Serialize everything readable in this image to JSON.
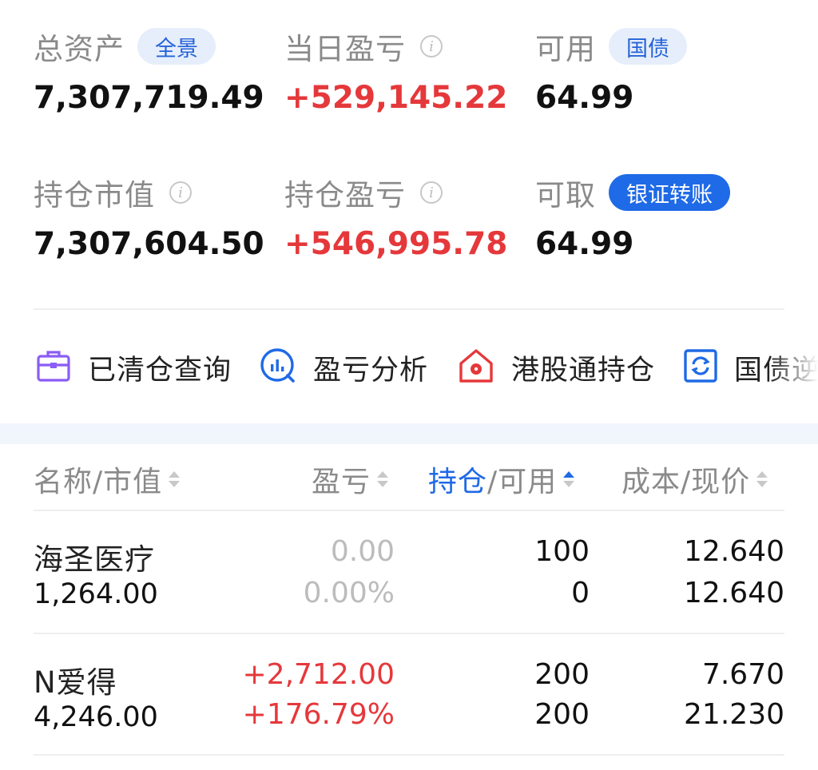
{
  "summary": {
    "total_assets": {
      "label": "总资产",
      "tag": "全景",
      "value": "7,307,719.49"
    },
    "today_pnl": {
      "label": "当日盈亏",
      "value": "+529,145.22"
    },
    "available": {
      "label": "可用",
      "tag": "国债",
      "value": "64.99"
    },
    "position_value": {
      "label": "持仓市值",
      "value": "7,307,604.50"
    },
    "position_pnl": {
      "label": "持仓盈亏",
      "value": "+546,995.78"
    },
    "withdrawable": {
      "label": "可取",
      "tag": "银证转账",
      "value": "64.99"
    }
  },
  "tools": [
    {
      "label": "已清仓查询",
      "icon": "briefcase-icon"
    },
    {
      "label": "盈亏分析",
      "icon": "analysis-icon"
    },
    {
      "label": "港股通持仓",
      "icon": "hk-house-icon"
    },
    {
      "label": "国债逆回购",
      "icon": "refresh-icon"
    }
  ],
  "table": {
    "headers": {
      "name": "名称/市值",
      "pnl": "盈亏",
      "position_a": "持仓",
      "position_b": "/可用",
      "cost": "成本/现价"
    },
    "rows": [
      {
        "name": "海圣医疗",
        "market_value": "1,264.00",
        "pnl": "0.00",
        "pnl_pct": "0.00%",
        "position": "100",
        "available": "0",
        "cost": "12.640",
        "price": "12.640"
      },
      {
        "name": "N爱得",
        "market_value": "4,246.00",
        "pnl": "+2,712.00",
        "pnl_pct": "+176.79%",
        "position": "200",
        "available": "200",
        "cost": "7.670",
        "price": "21.230"
      }
    ]
  },
  "colors": {
    "accent": "#1f6ae6",
    "gain": "#e5383b",
    "label": "#8a8a8a"
  }
}
